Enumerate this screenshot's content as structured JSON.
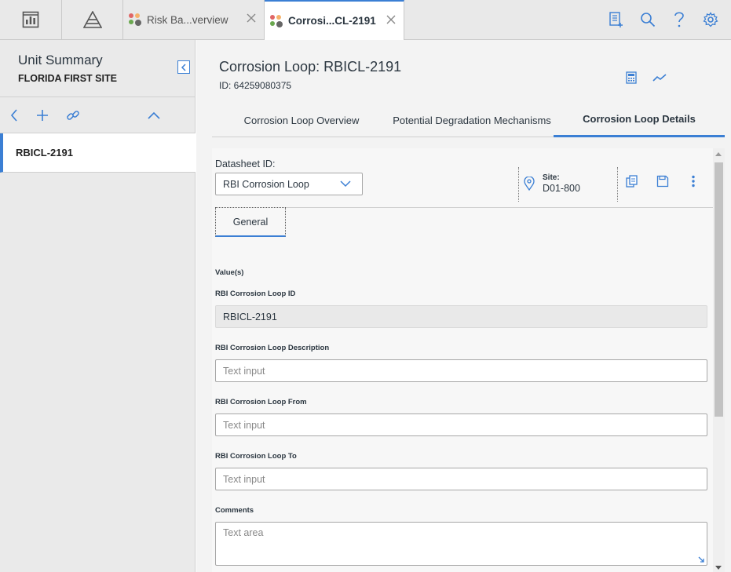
{
  "tabs": [
    {
      "label": "Risk Ba...verview"
    },
    {
      "label": "Corrosi...CL-2191"
    }
  ],
  "left_panel": {
    "title": "Unit Summary",
    "subtitle": "FLORIDA FIRST SITE",
    "items": [
      {
        "label": "RBICL-2191"
      }
    ]
  },
  "header": {
    "title": "Corrosion Loop: RBICL-2191",
    "id_text": "ID: 64259080375"
  },
  "subtabs": [
    {
      "label": "Corrosion Loop Overview"
    },
    {
      "label": "Potential Degradation Mechanisms"
    },
    {
      "label": "Corrosion Loop Details"
    }
  ],
  "datasheet": {
    "label": "Datasheet ID:",
    "selected": "RBI Corrosion Loop",
    "site_label": "Site:",
    "site_value": "D01-800",
    "section_tab": "General"
  },
  "form": {
    "section_label": "Value(s)",
    "fields": [
      {
        "label": "RBI Corrosion Loop ID",
        "value": "RBICL-2191"
      },
      {
        "label": "RBI Corrosion Loop Description",
        "placeholder": "Text input"
      },
      {
        "label": "RBI Corrosion Loop From",
        "placeholder": "Text input"
      },
      {
        "label": "RBI Corrosion Loop To",
        "placeholder": "Text input"
      },
      {
        "label": "Comments",
        "placeholder": "Text area"
      }
    ]
  },
  "colors": {
    "accent": "#3b7fd4",
    "text": "#2b3640",
    "panel": "#eaeaea"
  }
}
